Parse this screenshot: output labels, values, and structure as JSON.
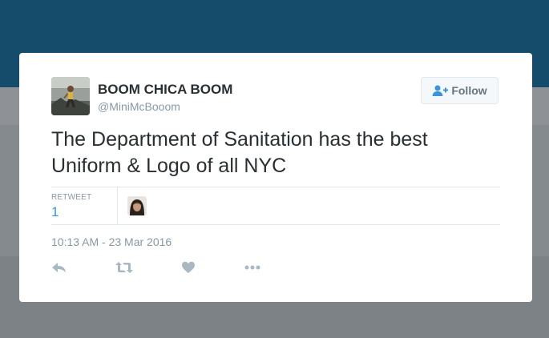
{
  "tweet": {
    "author_name": "BOOM CHICA BOOM",
    "author_handle": "@MiniMcBooom",
    "follow_label": "Follow",
    "text": "The Department of Sanitation has the best Uniform & Logo of all NYC",
    "retweet_label": "RETWEET",
    "retweet_count": "1",
    "timestamp": "10:13 AM - 23 Mar 2016",
    "actions": [
      "reply-icon",
      "retweet-icon",
      "like-icon",
      "more-icon"
    ]
  },
  "colors": {
    "header_blue": "#154c6b",
    "text_dark": "#292f33",
    "text_muted": "#8899a6",
    "link_blue": "#3b94d9",
    "action_gray": "#aab8c2"
  }
}
